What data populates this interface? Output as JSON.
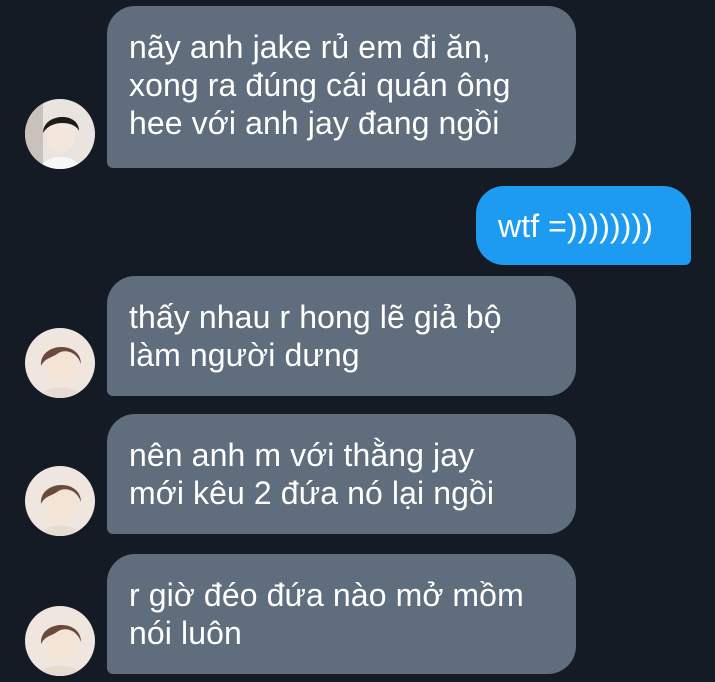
{
  "conversation": {
    "messages": [
      {
        "direction": "incoming",
        "text": "nãy anh jake rủ em đi ăn,\nxong ra đúng cái quán ông\nhee với anh jay đang ngồi",
        "avatar": "avatar-photo-1"
      },
      {
        "direction": "outgoing",
        "text": "wtf =))))))))"
      },
      {
        "direction": "incoming",
        "text": "thấy nhau r hong lẽ giả bộ\nlàm người dưng",
        "avatar": "avatar-photo-2"
      },
      {
        "direction": "incoming",
        "text": "nên anh m với thằng jay\nmới kêu 2 đứa nó lại ngồi",
        "avatar": "avatar-photo-2"
      },
      {
        "direction": "incoming",
        "text": "r giờ đéo đứa nào mở mồm\nnói luôn",
        "avatar": "avatar-photo-2"
      }
    ]
  },
  "colors": {
    "background": "#151b25",
    "incoming_bubble": "#5f6d7d",
    "outgoing_bubble": "#1d9bf0",
    "text": "#ffffff"
  }
}
